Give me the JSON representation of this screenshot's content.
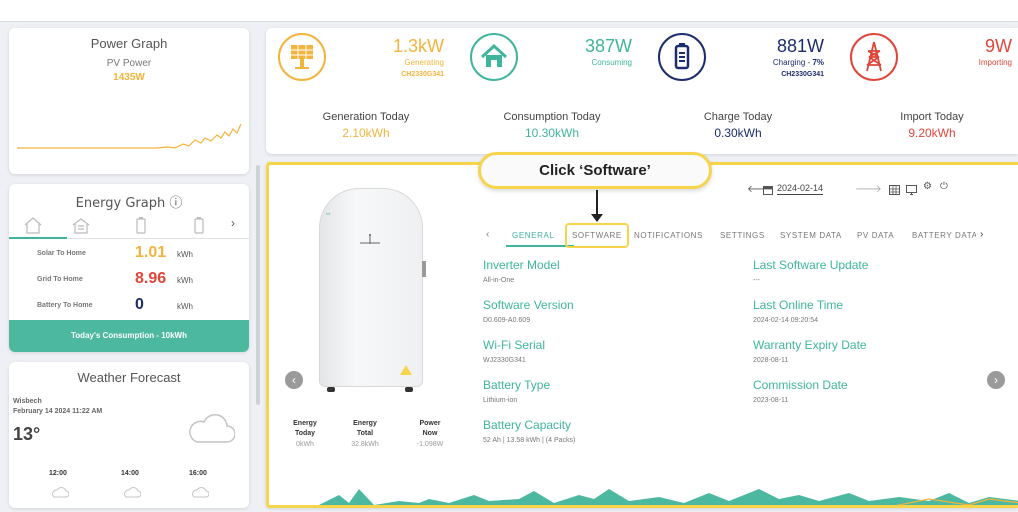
{
  "power_graph": {
    "title": "Power Graph",
    "subtitle": "PV Power",
    "value": "1435W"
  },
  "energy_graph": {
    "title": "Energy Graph ⓘ",
    "rows": [
      {
        "label": "Solar To Home",
        "value": "1.01",
        "unit": "kWh",
        "color": "#f2b43c"
      },
      {
        "label": "Grid To Home",
        "value": "8.96",
        "unit": "kWh",
        "color": "#e0453a"
      },
      {
        "label": "Battery To Home",
        "value": "0",
        "unit": "kWh",
        "color": "#1c2d6e"
      }
    ],
    "footer": "Today's Consumption - 10kWh",
    "next_icon": "chevron-right-icon"
  },
  "weather": {
    "title": "Weather Forecast",
    "location": "Wisbech",
    "datetime": "February 14 2024 11:22 AM",
    "temperature": "13°",
    "hours": [
      "12:00",
      "14:00",
      "16:00"
    ]
  },
  "stats": {
    "solar": {
      "value": "1.3kW",
      "status": "Generating",
      "device": "CH2330G341",
      "color": "#f2b43c"
    },
    "home": {
      "value": "387W",
      "status": "Consuming",
      "color": "#3fb59c"
    },
    "battery": {
      "value": "881W",
      "status_prefix": "Charging - ",
      "percent": "7%",
      "device": "CH2330G341",
      "color": "#1c2d6e"
    },
    "grid": {
      "value": "9W",
      "status": "Importing",
      "color": "#e0453a"
    }
  },
  "today": {
    "generation": {
      "label": "Generation Today",
      "value": "2.10kWh"
    },
    "consumption": {
      "label": "Consumption Today",
      "value": "10.30kWh"
    },
    "charge": {
      "label": "Charge Today",
      "value": "0.30kWh"
    },
    "import": {
      "label": "Import Today",
      "value": "9.20kWh"
    }
  },
  "inverter": {
    "date": "2024-02-14",
    "tabs": [
      "GENERAL",
      "SOFTWARE",
      "NOTIFICATIONS",
      "SETTINGS",
      "SYSTEM DATA",
      "PV DATA",
      "BATTERY DATA"
    ],
    "active_tab": "GENERAL",
    "fields_left": [
      {
        "key": "Inverter Model",
        "value": "All-in-One"
      },
      {
        "key": "Software Version",
        "value": "D0.609-A0.609"
      },
      {
        "key": "Wi-Fi Serial",
        "value": "WJ2330G341"
      },
      {
        "key": "Battery Type",
        "value": "Lithium-ion"
      },
      {
        "key": "Battery Capacity",
        "value": "52 Ah | 13.58 kWh | (4 Packs)"
      }
    ],
    "fields_right": [
      {
        "key": "Last Software Update",
        "value": "---"
      },
      {
        "key": "Last Online Time",
        "value": "2024-02-14 09:20:54"
      },
      {
        "key": "Warranty Expiry Date",
        "value": "2028-08-11"
      },
      {
        "key": "Commission Date",
        "value": "2023-08-11"
      }
    ],
    "device_stats": [
      {
        "h1": "Energy",
        "h2": "Today",
        "value": "0kWh"
      },
      {
        "h1": "Energy",
        "h2": "Total",
        "value": "32.8kWh"
      },
      {
        "h1": "Power",
        "h2": "Now",
        "value": "-1.098W"
      }
    ]
  },
  "callout": "Click ‘Software’"
}
